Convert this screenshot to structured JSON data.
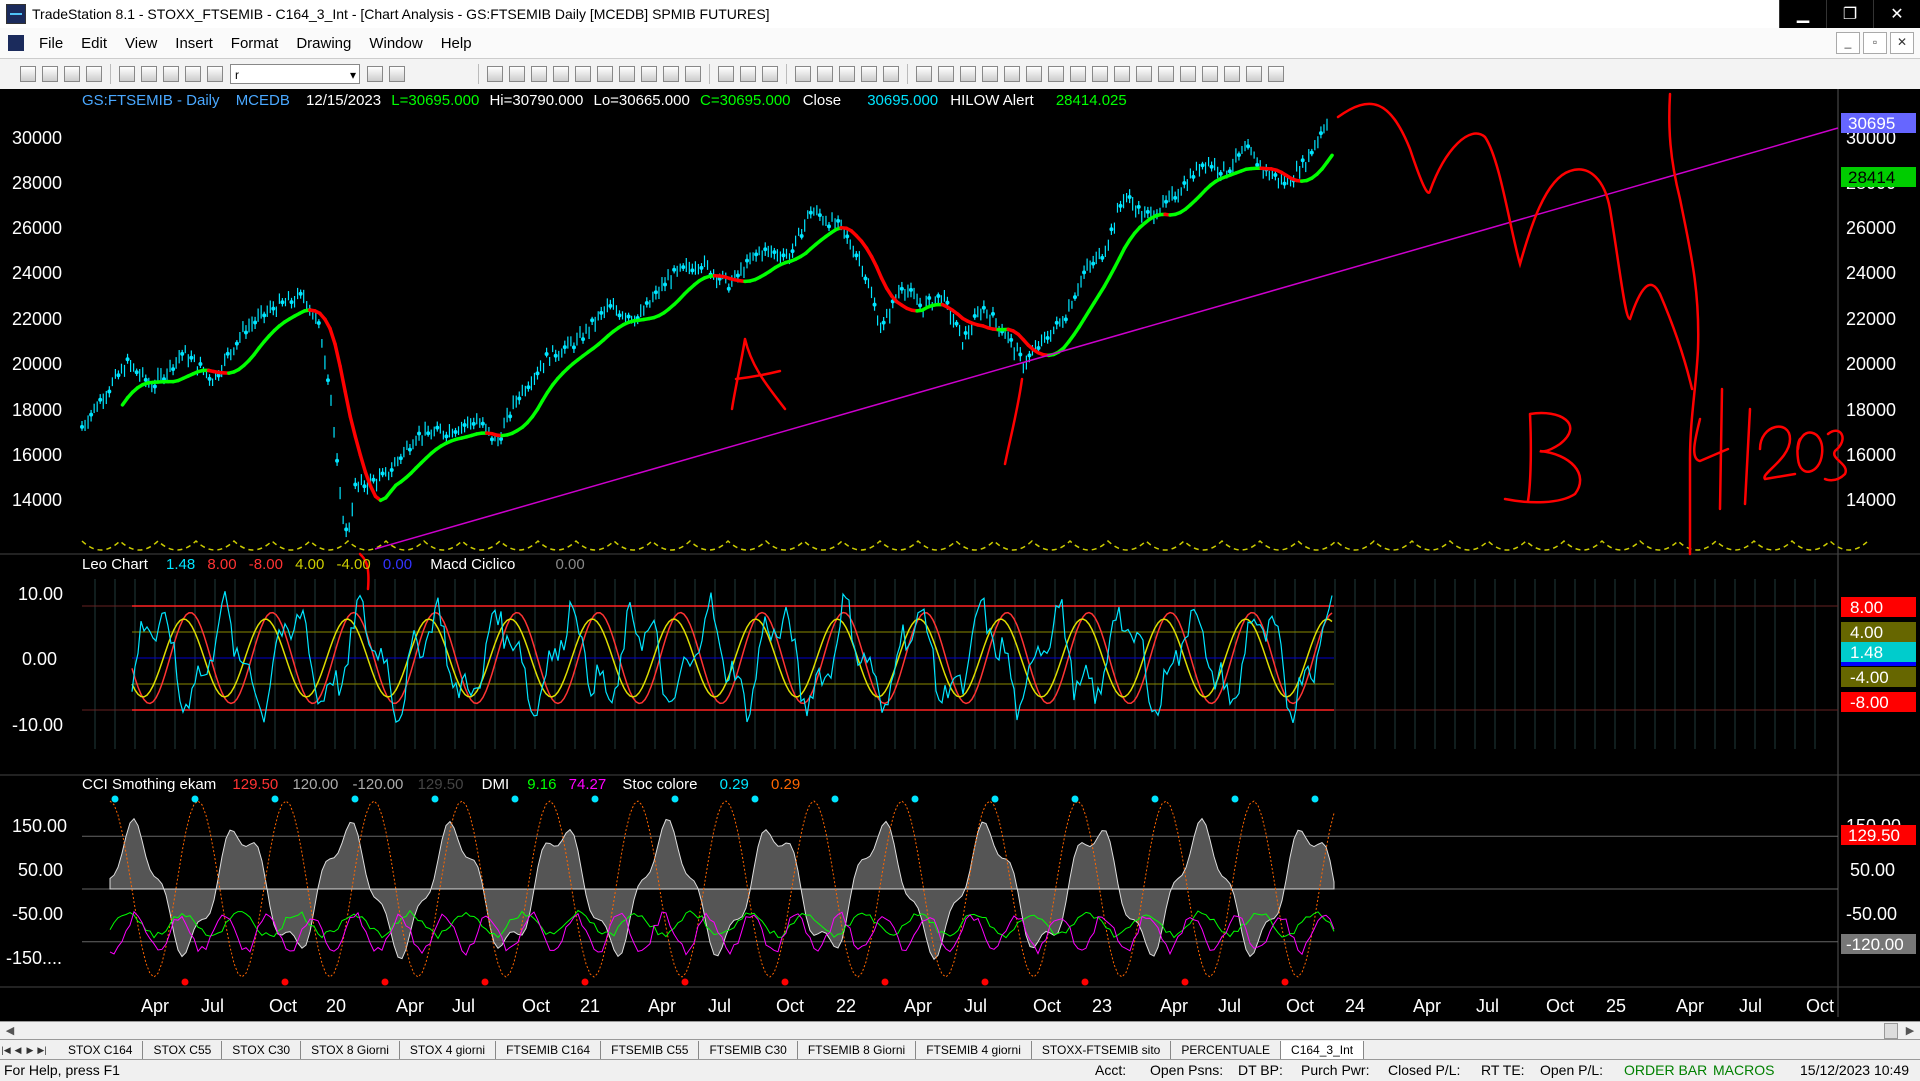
{
  "window": {
    "title": "TradeStation 8.1 - STOXX_FTSEMIB - C164_3_Int - [Chart Analysis - GS:FTSEMIB  Daily  [MCEDB] SPMIB FUTURES]",
    "minimize": "▁",
    "maximize": "❐",
    "close": "✕"
  },
  "menu": [
    "File",
    "Edit",
    "View",
    "Insert",
    "Format",
    "Drawing",
    "Window",
    "Help"
  ],
  "mdi_buttons": [
    "_",
    "▫",
    "✕"
  ],
  "toolbar": {
    "combo_value": "r"
  },
  "chart": {
    "header": {
      "symbol": "GS:FTSEMIB - Daily",
      "source": "MCEDB",
      "date": "12/15/2023",
      "last": "L=30695.000",
      "high": "Hi=30790.000",
      "low": "Lo=30665.000",
      "close_val": "C=30695.000",
      "close_label": "Close",
      "close_num": "30695.000",
      "hilow_label": "HILOW Alert",
      "hilow_val": "28414.025"
    },
    "price_axis": [
      "30000",
      "28000",
      "26000",
      "24000",
      "22000",
      "20000",
      "18000",
      "16000",
      "14000"
    ],
    "price_tags": {
      "last": "30695",
      "hilow": "28414"
    },
    "leo": {
      "title": "Leo Chart",
      "vals": [
        "1.48",
        "8.00",
        "-8.00",
        "4.00",
        "-4.00",
        "0.00"
      ],
      "macd_label": "Macd Ciclico",
      "macd_val": "0.00",
      "axis": [
        "10.00",
        "0.00",
        "-10.00"
      ],
      "tags": [
        "8.00",
        "4.00",
        "1.48",
        "-4.00",
        "-8.00"
      ]
    },
    "cci": {
      "title": "CCI Smothing ekam",
      "vals": [
        "129.50",
        "120.00",
        "-120.00",
        "129.50"
      ],
      "dmi_label": "DMI",
      "dmi_vals": [
        "9.16",
        "74.27"
      ],
      "stoc_label": "Stoc colore",
      "stoc_vals": [
        "0.29",
        "0.29"
      ],
      "axis": [
        "150.00",
        "50.00",
        "-50.00",
        "-150...."
      ],
      "tags": [
        "129.50",
        "-120.00"
      ]
    },
    "time_axis": [
      "Apr",
      "Jul",
      "Oct",
      "20",
      "Apr",
      "Jul",
      "Oct",
      "21",
      "Apr",
      "Jul",
      "Oct",
      "22",
      "Apr",
      "Jul",
      "Oct",
      "23",
      "Apr",
      "Jul",
      "Oct",
      "24",
      "Apr",
      "Jul",
      "Oct",
      "25",
      "Apr",
      "Jul",
      "Oct"
    ],
    "annotations": {
      "a": "A",
      "b": "B",
      "one": "1",
      "date": "4|2025"
    }
  },
  "tabs": [
    "STOX C164",
    "STOX C55",
    "STOX  C30",
    "STOX  8 Giorni",
    "STOX 4 giorni",
    "FTSEMIB C164",
    "FTSEMIB C55",
    "FTSEMIB C30",
    "FTSEMIB  8 Giorni",
    "FTSEMIB  4 giorni",
    "STOXX-FTSEMIB sito",
    "PERCENTUALE",
    "C164_3_Int"
  ],
  "active_tab": "C164_3_Int",
  "status": {
    "help": "For Help, press F1",
    "acct": "Acct:",
    "open_psns": "Open Psns:",
    "dt_bp": "DT BP:",
    "purch_pwr": "Purch Pwr:",
    "closed_pl": "Closed P/L:",
    "rt_te": "RT TE:",
    "open_pl": "Open P/L:",
    "order_bar": "ORDER BAR",
    "macros": "MACROS",
    "datetime": "15/12/2023 10:49"
  },
  "colors": {
    "price_bars": "#00e5ff",
    "ma_green": "#00ff00",
    "ma_red": "#ff0000",
    "trendline": "#cc00cc",
    "handwriting": "#ff0000",
    "tag_last": "#6666ff",
    "tag_hilow": "#00cc00"
  }
}
